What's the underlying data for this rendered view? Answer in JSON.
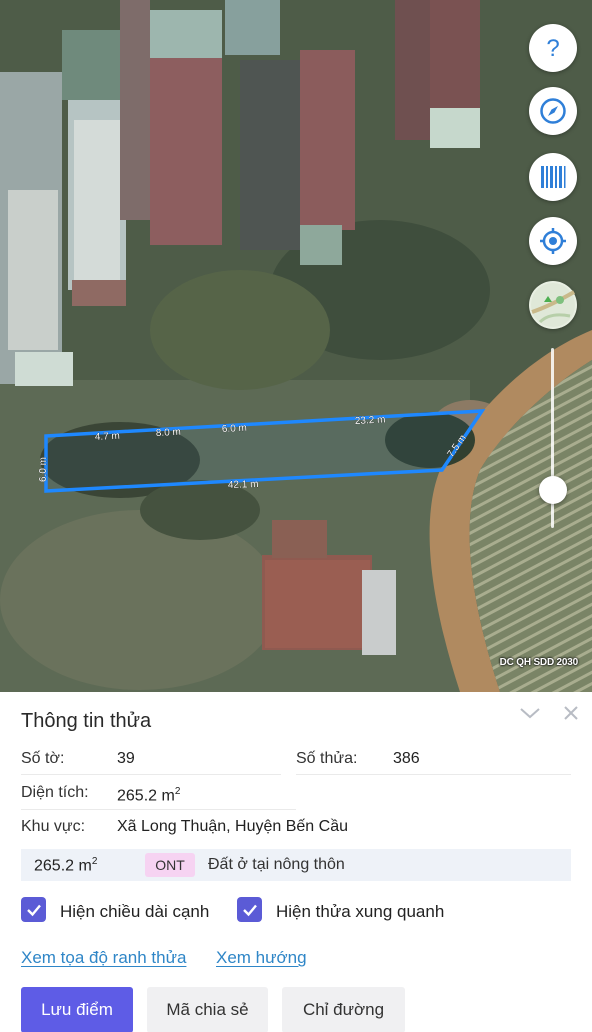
{
  "map": {
    "label": "DC QH SDD 2030",
    "buttons": [
      {
        "icon": "help-icon"
      },
      {
        "icon": "compass-icon"
      },
      {
        "icon": "barcode-icon"
      },
      {
        "icon": "locate-icon"
      },
      {
        "icon": "map-layer-icon"
      }
    ],
    "parcel_edges": {
      "top_1": "4.7 m",
      "top_2": "8.0 m",
      "top_3": "6.0 m",
      "top_4": "23.2 m",
      "right": "7.5 m",
      "bottom": "42.1 m",
      "left": "6.0 m"
    },
    "parcel_color": "#1e88ff"
  },
  "panel": {
    "title": "Thông tin thửa",
    "so_to_label": "Số tờ:",
    "so_to_value": "39",
    "so_thua_label": "Số thửa:",
    "so_thua_value": "386",
    "dien_tich_label": "Diện tích:",
    "dien_tich_value": "265.2 m",
    "dien_tich_unit_sup": "2",
    "khu_vuc_label": "Khu vực:",
    "khu_vuc_value": "Xã Long Thuận, Huyện Bến Cầu",
    "land_use": {
      "area": "265.2 m",
      "area_sup": "2",
      "code": "ONT",
      "description": "Đất ở tại nông thôn"
    },
    "checkbox_edges": {
      "label": "Hiện chiều dài cạnh",
      "checked": true
    },
    "checkbox_neighbors": {
      "label": "Hiện thửa xung quanh",
      "checked": true
    },
    "link_coords": "Xem tọa độ ranh thửa",
    "link_direction": "Xem hướng",
    "btn_save": "Lưu điểm",
    "btn_share": "Mã chia sẻ",
    "btn_directions": "Chỉ đường",
    "accent_color": "#5e5ce6",
    "link_color": "#2f86c7"
  }
}
